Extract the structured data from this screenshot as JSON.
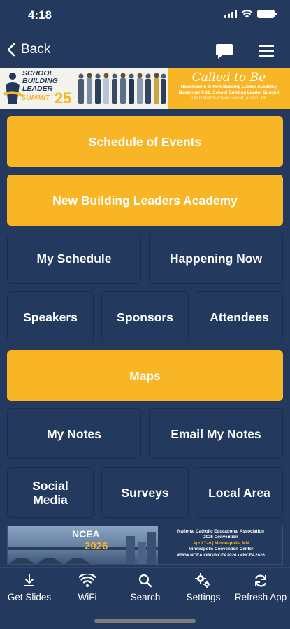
{
  "status": {
    "time": "4:18"
  },
  "nav": {
    "back_label": "Back"
  },
  "top_banner": {
    "summit_line1": "SCHOOL",
    "summit_line2": "BUILDING",
    "summit_line3": "LEADER",
    "summit_line4": "SUMMIT",
    "summit_year": "25",
    "called_title": "Called to Be",
    "line1": "November 5-7: New Building Leader Academy",
    "line2": "November 9-11: School Building Leader Summit",
    "line3": "Omni Barton Creek Resort, Austin, TX"
  },
  "tiles": {
    "schedule_of_events": "Schedule of Events",
    "new_building_leaders": "New Building Leaders Academy",
    "my_schedule": "My Schedule",
    "happening_now": "Happening Now",
    "speakers": "Speakers",
    "sponsors": "Sponsors",
    "attendees": "Attendees",
    "maps": "Maps",
    "my_notes": "My Notes",
    "email_my_notes": "Email My Notes",
    "social_media": "Social Media",
    "surveys": "Surveys",
    "local_area": "Local Area"
  },
  "bottom_banner": {
    "logo": "NCEA",
    "year": "2026",
    "line1": "National Catholic Educational Association",
    "line2": "2026 Convention",
    "line3": "April 7–9 | Minneapolis, MN",
    "line4": "Minneapolis Convention Center",
    "line5": "WWW.NCEA.ORG/NCEA2026 • #NCEA2026"
  },
  "tabs": [
    {
      "label": "Get Slides",
      "icon": "download-icon"
    },
    {
      "label": "WiFi",
      "icon": "wifi-icon"
    },
    {
      "label": "Search",
      "icon": "search-icon"
    },
    {
      "label": "Settings",
      "icon": "gear-icon"
    },
    {
      "label": "Refresh App",
      "icon": "refresh-icon"
    }
  ],
  "colors": {
    "navy": "#23395d",
    "gold": "#f8b525"
  }
}
